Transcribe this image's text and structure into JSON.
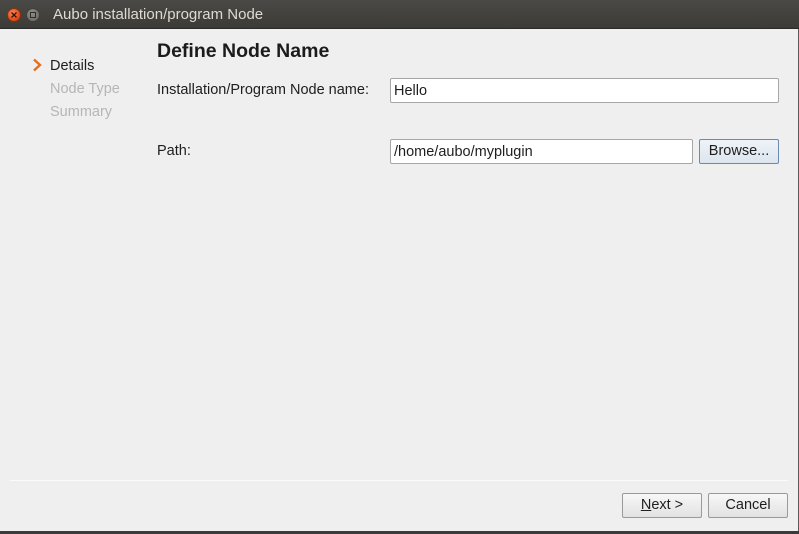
{
  "window": {
    "title": "Aubo installation/program Node"
  },
  "sidebar": {
    "steps": [
      {
        "label": "Details",
        "state": "active"
      },
      {
        "label": "Node Type",
        "state": "inactive"
      },
      {
        "label": "Summary",
        "state": "inactive"
      }
    ]
  },
  "main": {
    "heading": "Define Node Name",
    "name_label": "Installation/Program Node name:",
    "name_value": "Hello",
    "path_label": "Path:",
    "path_value": "/home/aubo/myplugin",
    "browse_label": "Browse..."
  },
  "footer": {
    "next_label_accel": "N",
    "next_label_rest": "ext >",
    "cancel_label": "Cancel"
  },
  "colors": {
    "accent_chevron": "#e0701e",
    "close_button": "#e4501c",
    "titlebar": "#3c3b37"
  },
  "icons": {
    "close": "close-icon",
    "minimize": "minimize-icon",
    "step_current": "chevron-right-icon"
  }
}
